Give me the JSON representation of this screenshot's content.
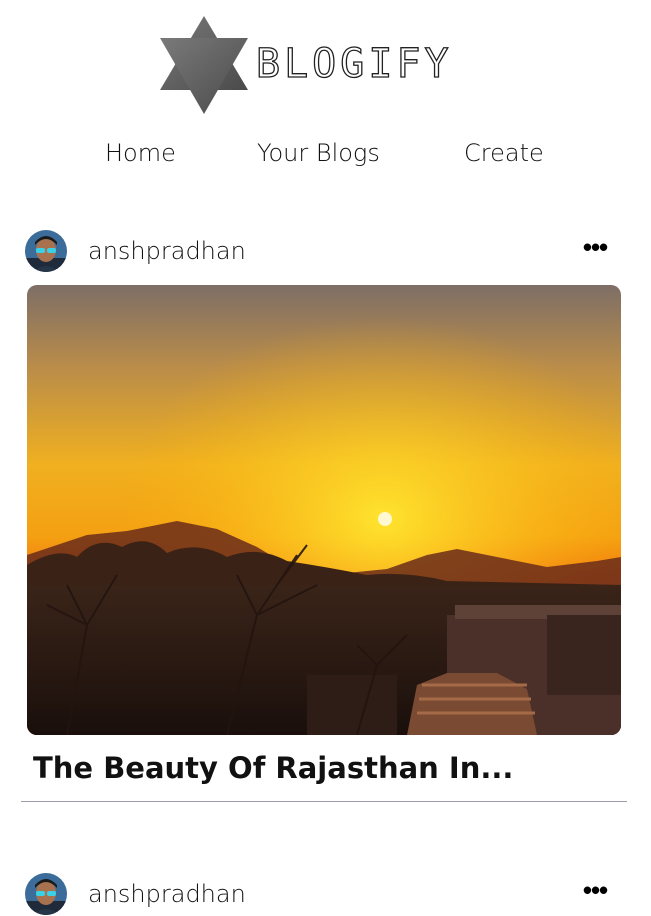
{
  "brand": {
    "name": "BLOGIFY",
    "logo_icon": "hexagram-star-icon",
    "logo_color": "#5a5a5a"
  },
  "nav": {
    "items": [
      {
        "label": "Home"
      },
      {
        "label": "Your Blogs"
      },
      {
        "label": "Create"
      }
    ]
  },
  "posts": [
    {
      "author": "anshpradhan",
      "avatar": "avatar-icon",
      "menu_icon": "more-options-icon",
      "menu_label": "•••",
      "image": "sunset-over-hills-photo",
      "title": "The Beauty Of Rajasthan In..."
    },
    {
      "author": "anshpradhan",
      "avatar": "avatar-icon",
      "menu_icon": "more-options-icon",
      "menu_label": "•••"
    }
  ],
  "colors": {
    "divider": "#9b9bab",
    "text": "#111111",
    "background": "#ffffff"
  }
}
